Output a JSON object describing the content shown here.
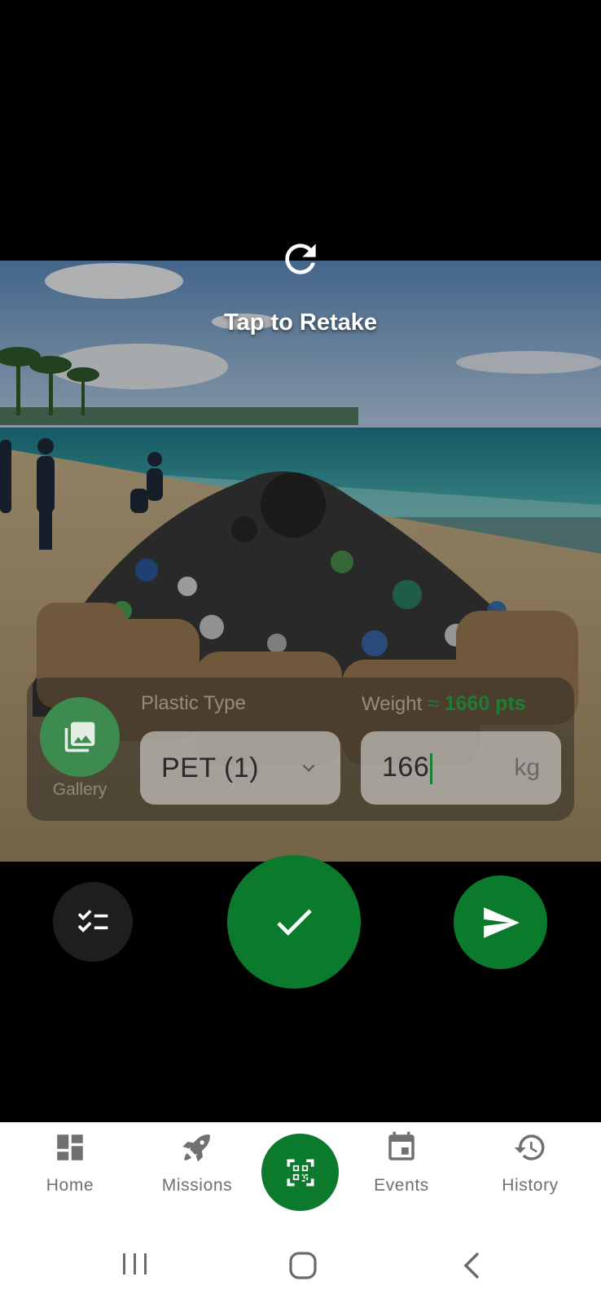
{
  "retake": {
    "label": "Tap to Retake",
    "icon": "refresh-icon"
  },
  "form": {
    "gallery_label": "Gallery",
    "plastic_type_label": "Plastic Type",
    "plastic_type_value": "PET (1)",
    "weight_label": "Weight",
    "points_prefix": "≈",
    "points_value": "1660 pts",
    "weight_value": "166",
    "weight_unit": "kg"
  },
  "actions": {
    "checklist_icon": "checklist-icon",
    "confirm_icon": "check-icon",
    "send_icon": "send-icon"
  },
  "nav": {
    "items": [
      {
        "label": "Home",
        "icon": "dashboard-icon"
      },
      {
        "label": "Missions",
        "icon": "rocket-icon"
      },
      {
        "label": "Events",
        "icon": "calendar-icon"
      },
      {
        "label": "History",
        "icon": "history-icon"
      }
    ],
    "center_icon": "qr-scan-icon"
  },
  "colors": {
    "primary_green": "#0c7a2c",
    "points_green": "#1a7f32"
  }
}
